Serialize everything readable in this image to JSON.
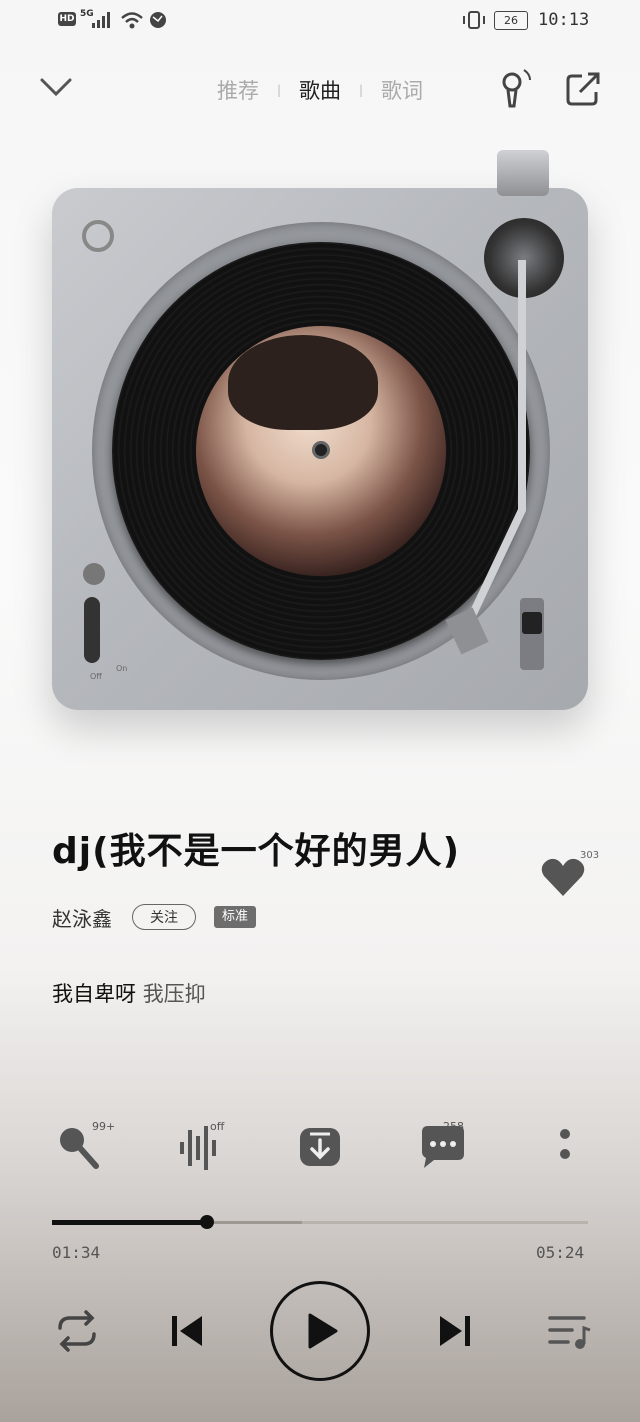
{
  "status_bar": {
    "hd": "HD",
    "network": "5G",
    "battery": "26",
    "time": "10:13"
  },
  "header": {
    "tabs": [
      {
        "label": "推荐"
      },
      {
        "label": "歌曲"
      },
      {
        "label": "歌词"
      }
    ],
    "active_tab": "歌曲"
  },
  "player_art": {
    "switch_off": "Off",
    "switch_on": "On"
  },
  "song": {
    "title": "dj(我不是一个好的男人)",
    "artist": "赵泳鑫",
    "follow_label": "关注",
    "quality_badge": "标准",
    "likes": "303",
    "lyric_sung": "我自卑呀",
    "lyric_rest": "我压抑"
  },
  "actions": {
    "sing_badge": "99+",
    "effect_badge": "off",
    "comments_badge": "258"
  },
  "progress": {
    "current": "01:34",
    "total": "05:24",
    "played_fraction": 0.29
  },
  "colors": {
    "accent": "#111111",
    "deck": "#b5b8bd"
  }
}
